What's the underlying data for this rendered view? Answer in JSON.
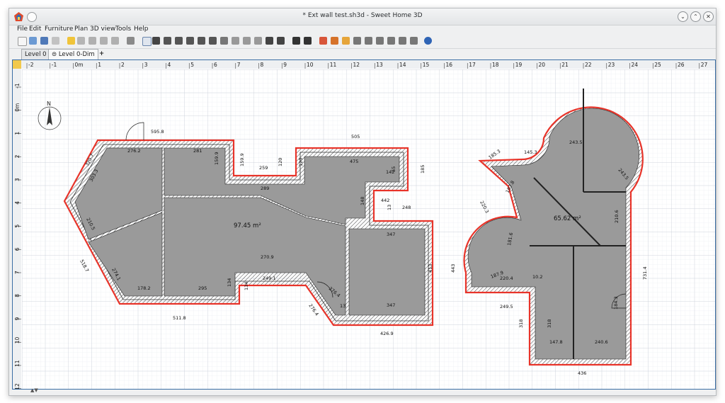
{
  "window": {
    "title": "* Ext wall test.sh3d - Sweet Home 3D",
    "app_icon": "sweet-home-3d-logo-icon"
  },
  "menu": [
    {
      "label": "File"
    },
    {
      "label": "Edit"
    },
    {
      "label": "Furniture"
    },
    {
      "label": "Plan"
    },
    {
      "label": "3D view"
    },
    {
      "label": "Tools"
    },
    {
      "label": "Help"
    }
  ],
  "toolbar_icons": [
    "new-icon",
    "open-icon",
    "save-icon",
    "cut-tool-icon",
    "undo-icon",
    "redo-icon",
    "cut-icon",
    "copy-icon",
    "paste-icon",
    "add-furniture-icon",
    "select-icon",
    "pan-icon",
    "create-walls-icon",
    "create-rooms-icon",
    "create-polylines-icon",
    "create-dimensions-icon",
    "create-labels-icon",
    "text-style-icon",
    "increase-text-icon",
    "decrease-text-icon",
    "bold-icon",
    "italic-icon",
    "zoom-in-icon",
    "zoom-out-icon",
    "create-photo-icon",
    "create-video-icon",
    "preferences-icon",
    "walls-icon",
    "rooms-icon",
    "furniture-icon",
    "split-icon",
    "join-icon",
    "flip-icon",
    "mirror-icon",
    "modify-icon",
    "check-icon",
    "help-icon"
  ],
  "tabs": [
    {
      "label": "Level 0"
    },
    {
      "label": "Level 0-Dim",
      "active": true
    }
  ],
  "ruler": {
    "h_labels": [
      "-2",
      "-1",
      "0m",
      "1",
      "2",
      "3",
      "4",
      "5",
      "6",
      "7",
      "8",
      "9",
      "10",
      "11",
      "12",
      "13",
      "14",
      "15",
      "16",
      "17",
      "18",
      "19",
      "20",
      "21",
      "22",
      "23",
      "24",
      "25",
      "26",
      "27"
    ],
    "v_labels": [
      "-1",
      "0m",
      "1",
      "2",
      "3",
      "4",
      "5",
      "6",
      "7",
      "8",
      "9",
      "10",
      "11",
      "12"
    ]
  },
  "compass": {
    "label": "N"
  },
  "rooms": [
    {
      "area": "97.45 m²"
    },
    {
      "area": "65.62 m²"
    }
  ],
  "dimensions_left": [
    "595.8",
    "276.2",
    "281",
    "159.9",
    "159.9",
    "259",
    "120",
    "120",
    "289",
    "505",
    "475",
    "142",
    "55",
    "185",
    "148",
    "442",
    "13",
    "248",
    "347",
    "413",
    "443",
    "347",
    "426.9",
    "13",
    "270.9",
    "249.1",
    "134",
    "134",
    "295",
    "178.2",
    "511.8",
    "276.4",
    "274.1",
    "518.7",
    "210.5",
    "303.3",
    "320.7",
    "276.4"
  ],
  "dimensions_right": [
    "145.3",
    "185.3",
    "243.5",
    "243.5",
    "220.3",
    "187.8",
    "65.62",
    "181.6",
    "220.4",
    "187.9",
    "249.5",
    "10.2",
    "210.6",
    "731.4",
    "318",
    "318",
    "147.8",
    "240.6",
    "436",
    "184.3"
  ],
  "colors": {
    "wall_outline": "#e8342a",
    "room_fill": "#9a9a9a",
    "grid": "#d7dbe3",
    "accent": "#3b6ea5"
  }
}
